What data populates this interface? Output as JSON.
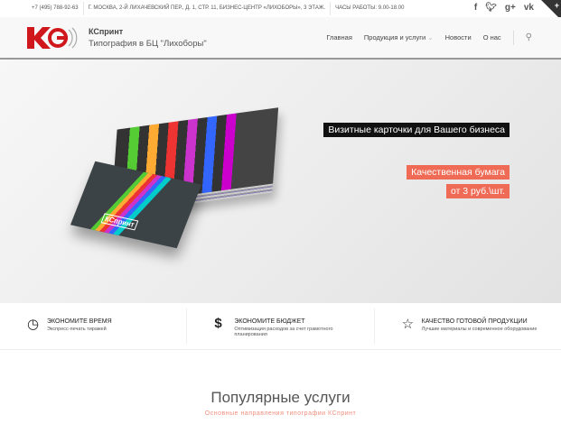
{
  "topbar": {
    "phone": "+7 (495) 788-92-63",
    "address": "Г. МОСКВА, 2-Й ЛИХАЧЕВСКИЙ ПЕР., Д. 1, СТР. 11, БИЗНЕС-ЦЕНТР «ЛИХОБОРЫ», 3 ЭТАЖ.",
    "hours": "ЧАСЫ РАБОТЫ: 9.00-18.00",
    "social": [
      "f",
      "🐦",
      "g+",
      "vk"
    ]
  },
  "header": {
    "brand": "КСпринт",
    "tagline": "Типография в БЦ \"Лихоборы\"",
    "logo_text": "КС",
    "nav": [
      "Главная",
      "Продукция и услуги",
      "Новости",
      "О нас"
    ]
  },
  "hero": {
    "caption1": "Визитные карточки для Вашего бизнеса",
    "caption2": "Качественная бумага",
    "caption3": "от 3 руб.\\шт.",
    "card_label": "КСпринт"
  },
  "features": [
    {
      "icon": "clock-icon",
      "title": "ЭКОНОМИТЕ ВРЕМЯ",
      "desc": "Экспресс-печать тиражей"
    },
    {
      "icon": "dollar-icon",
      "title": "ЭКОНОМИТЕ БЮДЖЕТ",
      "desc": "Оптимизация расходов за счет грамотного планирования"
    },
    {
      "icon": "star-icon",
      "title": "КАЧЕСТВО ГОТОВОЙ ПРОДУКЦИИ",
      "desc": "Лучшие материалы и современное оборудование"
    }
  ],
  "popular": {
    "title": "Популярные услуги",
    "subtitle": "Основные направления типографии КСпринт"
  },
  "colors": {
    "accent": "#ef6b55",
    "logo_red": "#d0171b"
  }
}
